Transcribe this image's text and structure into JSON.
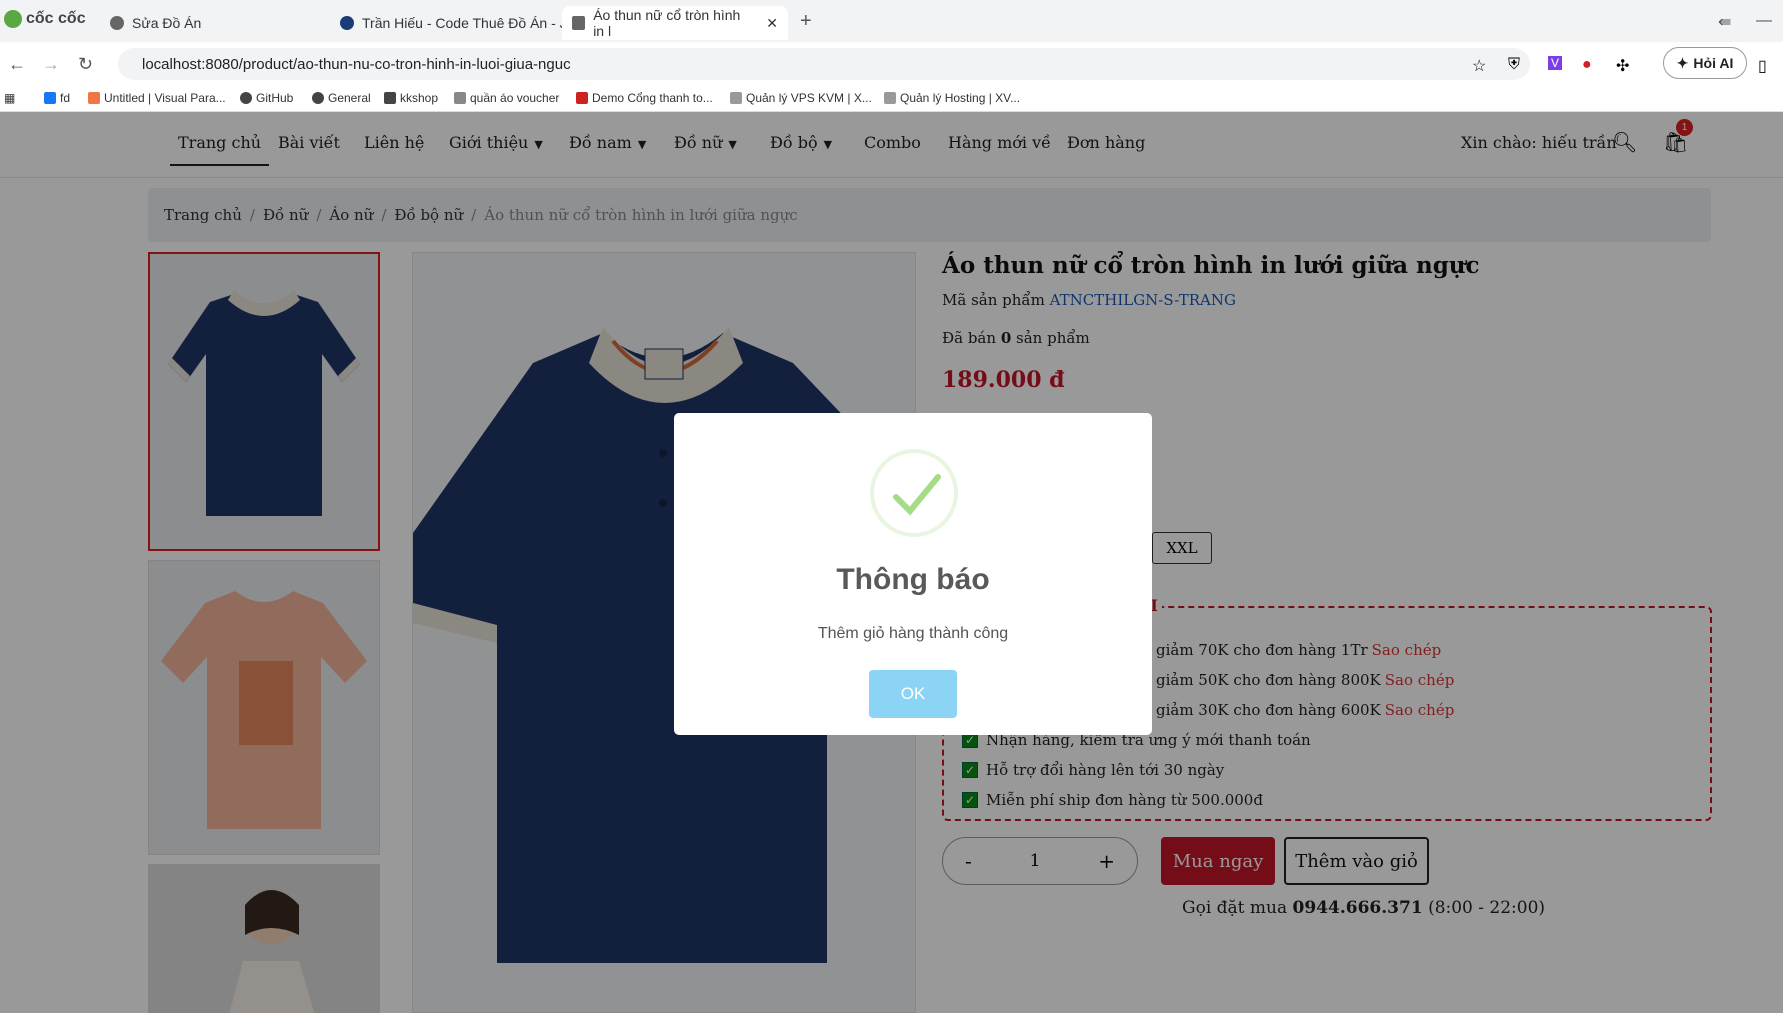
{
  "browser": {
    "logo": "cốc cốc",
    "tabs": [
      {
        "title": "Sửa Đồ Án"
      },
      {
        "title": "Trần Hiếu - Code Thuê Đồ Án - J"
      },
      {
        "title": "Áo thun nữ cổ tròn hình in l"
      }
    ],
    "url": "localhost:8080/product/ao-thun-nu-co-tron-hinh-in-luoi-giua-nguc",
    "ai_button": "Hỏi AI",
    "bookmarks": [
      "fd",
      "Untitled | Visual Para...",
      "GitHub",
      "General",
      "kkshop",
      "quần áo voucher",
      "Demo Cổng thanh to...",
      "Quản lý VPS KVM | X...",
      "Quản lý Hosting | XV..."
    ]
  },
  "nav": {
    "items": [
      {
        "label": "Trang chủ",
        "dropdown": false
      },
      {
        "label": "Bài viết",
        "dropdown": false
      },
      {
        "label": "Liên hệ",
        "dropdown": false
      },
      {
        "label": "Giới thiệu",
        "dropdown": true
      },
      {
        "label": "Đồ nam",
        "dropdown": true
      },
      {
        "label": "Đồ nữ",
        "dropdown": true
      },
      {
        "label": "Đồ bộ",
        "dropdown": true
      },
      {
        "label": "Combo",
        "dropdown": false
      },
      {
        "label": "Hàng mới về",
        "dropdown": false
      },
      {
        "label": "Đơn hàng",
        "dropdown": false
      }
    ],
    "greeting": "Xin chào: hiếu trần",
    "cart_count": "1"
  },
  "breadcrumb": [
    "Trang chủ",
    "Đồ nữ",
    "Áo nữ",
    "Đồ bộ nữ",
    "Áo thun nữ cổ tròn hình in lưới giữa ngực"
  ],
  "product": {
    "name": "Áo thun nữ cổ tròn hình in lưới giữa ngực",
    "code_label": "Mã sản phẩm",
    "code": "ATNCTHILGN-S-TRANG",
    "sold_prefix": "Đã bán",
    "sold_count": "0",
    "sold_suffix": "sản phẩm",
    "price": "189.000 đ",
    "size_visible": "XXL",
    "promo_title": "ÃI",
    "promo_lines": [
      {
        "text": "K giảm 70K cho đơn hàng 1Tr",
        "copy": "Sao chép"
      },
      {
        "text": "K giảm 50K cho đơn hàng 800K",
        "copy": "Sao chép"
      },
      {
        "text": "K giảm 30K cho đơn hàng 600K",
        "copy": "Sao chép"
      }
    ],
    "check_lines": [
      "Nhận hàng, kiểm tra ưng ý mới thanh toán",
      "Hỗ trợ đổi hàng lên tới 30 ngày",
      "Miễn phí ship đơn hàng từ 500.000đ"
    ],
    "qty_minus": "-",
    "qty_value": "1",
    "qty_plus": "+",
    "buy_now": "Mua ngay",
    "add_to_cart": "Thêm vào giỏ",
    "hotline_prefix": "Gọi đặt mua",
    "hotline_number": "0944.666.371",
    "hotline_hours": "(8:00 - 22:00)"
  },
  "modal": {
    "title": "Thông báo",
    "message": "Thêm giỏ hàng thành công",
    "ok": "OK"
  },
  "colors": {
    "accent_red": "#c4162a",
    "shirt_navy": "#1f3566",
    "shirt_peach": "#f2b59c",
    "ok_button": "#8cd4f5"
  }
}
